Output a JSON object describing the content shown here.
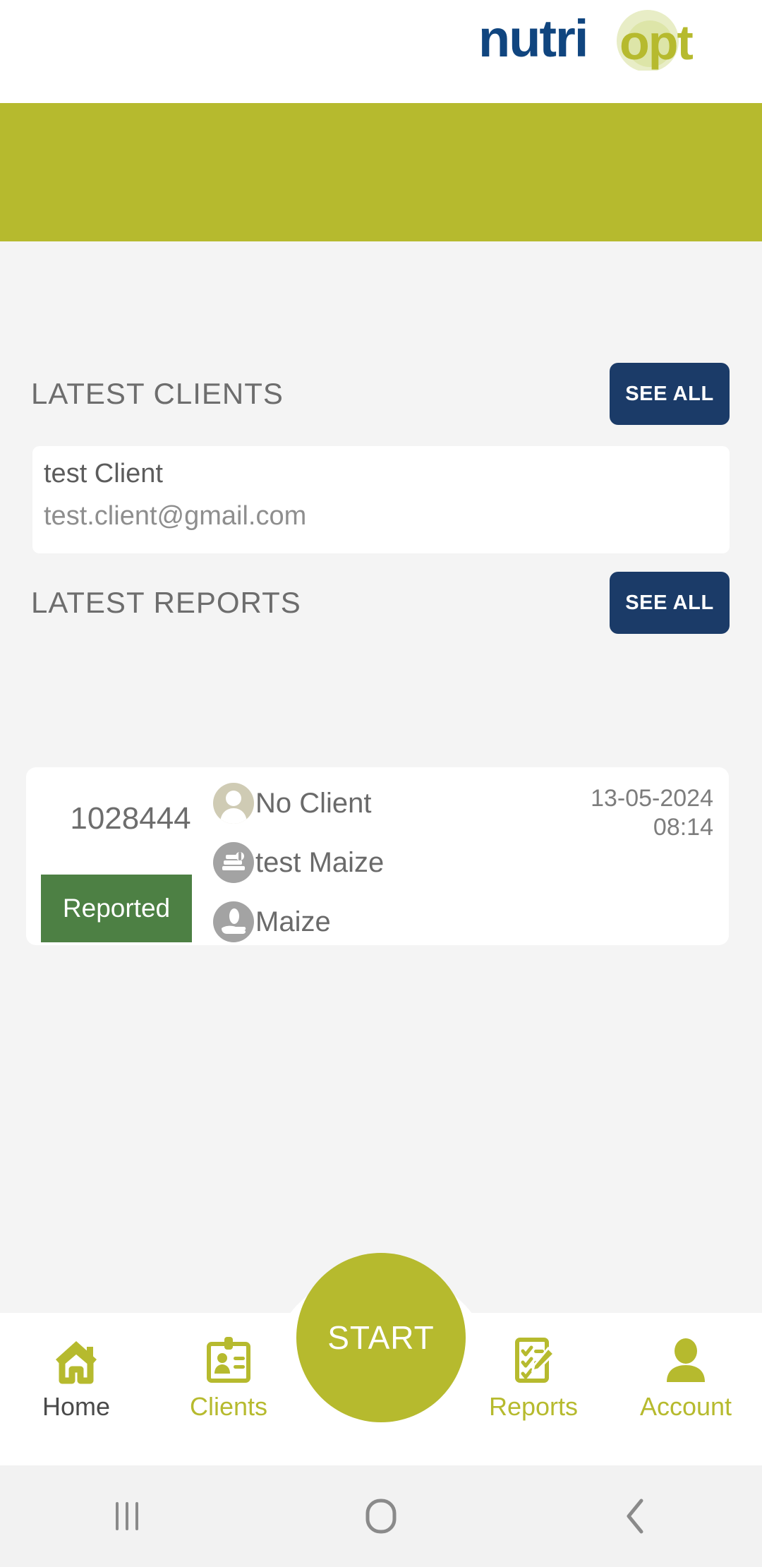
{
  "app": {
    "logo_text_primary": "nutri",
    "logo_text_accent": "opt",
    "brand_navy": "#10457f",
    "brand_olive": "#b6ba2e",
    "brand_olive_light": "#e4e9b8",
    "banner_color": "#b6ba2e",
    "page_background": "#f4f4f4"
  },
  "sections": {
    "clients": {
      "title": "LATEST CLIENTS",
      "see_all_label": "SEE ALL",
      "items": [
        {
          "name": "test Client",
          "email": "test.client@gmail.com"
        }
      ]
    },
    "reports": {
      "title": "LATEST REPORTS",
      "see_all_label": "SEE ALL",
      "items": [
        {
          "id": "1028444",
          "status": "Reported",
          "status_color": "#4d8044",
          "client": "No Client",
          "sample": "test Maize",
          "crop": "Maize",
          "date": "13-05-2024",
          "time": "08:14",
          "client_icon": "person-avatar-icon",
          "sample_icon": "sample-stack-icon",
          "crop_icon": "hand-seedling-icon"
        }
      ]
    }
  },
  "start_button": {
    "label": "START"
  },
  "bottom_nav": {
    "items": [
      {
        "label": "Home",
        "icon": "home-icon",
        "active": true
      },
      {
        "label": "Clients",
        "icon": "id-card-icon",
        "active": false
      },
      {
        "label": "Reports",
        "icon": "clipboard-pencil-icon",
        "active": false
      },
      {
        "label": "Account",
        "icon": "person-icon",
        "active": false
      }
    ]
  },
  "system_nav": {
    "recents": "recents-icon",
    "home": "home-circle-icon",
    "back": "back-chevron-icon"
  }
}
